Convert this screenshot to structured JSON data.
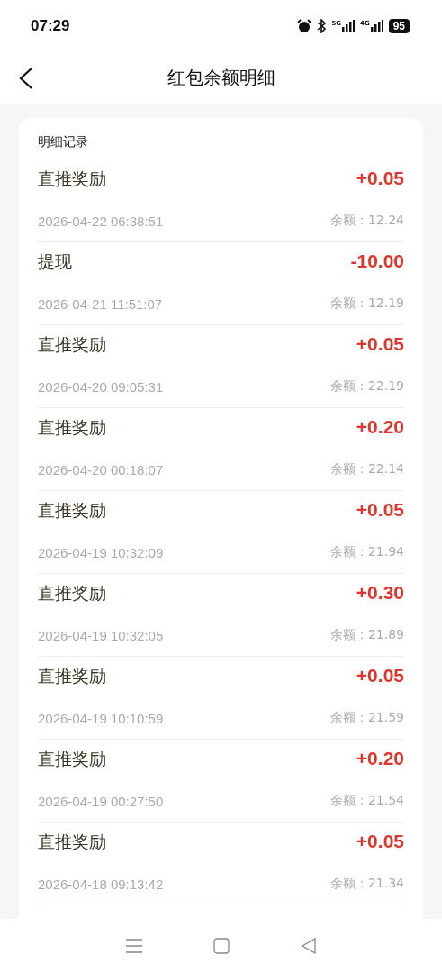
{
  "status_bar": {
    "time": "07:29",
    "network_1": "5G",
    "network_2": "4G",
    "battery": "95"
  },
  "header": {
    "title": "红包余额明细"
  },
  "card": {
    "title": "明细记录",
    "records": [
      {
        "name": "直推奖励",
        "time": "2026-04-22 06:38:51",
        "amount": "+0.05",
        "balance_label": "余额：",
        "balance": "12.24"
      },
      {
        "name": "提现",
        "time": "2026-04-21 11:51:07",
        "amount": "-10.00",
        "balance_label": "余额：",
        "balance": "12.19"
      },
      {
        "name": "直推奖励",
        "time": "2026-04-20 09:05:31",
        "amount": "+0.05",
        "balance_label": "余额：",
        "balance": "22.19"
      },
      {
        "name": "直推奖励",
        "time": "2026-04-20 00:18:07",
        "amount": "+0.20",
        "balance_label": "余额：",
        "balance": "22.14"
      },
      {
        "name": "直推奖励",
        "time": "2026-04-19 10:32:09",
        "amount": "+0.05",
        "balance_label": "余额：",
        "balance": "21.94"
      },
      {
        "name": "直推奖励",
        "time": "2026-04-19 10:32:05",
        "amount": "+0.30",
        "balance_label": "余额：",
        "balance": "21.89"
      },
      {
        "name": "直推奖励",
        "time": "2026-04-19 10:10:59",
        "amount": "+0.05",
        "balance_label": "余额：",
        "balance": "21.59"
      },
      {
        "name": "直推奖励",
        "time": "2026-04-19 00:27:50",
        "amount": "+0.20",
        "balance_label": "余额：",
        "balance": "21.54"
      },
      {
        "name": "直推奖励",
        "time": "2026-04-18 09:13:42",
        "amount": "+0.05",
        "balance_label": "余额：",
        "balance": "21.34"
      }
    ]
  }
}
